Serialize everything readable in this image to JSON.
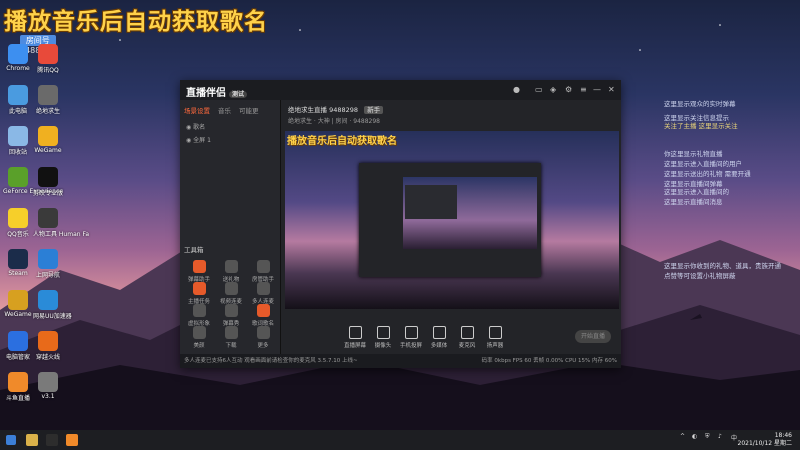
{
  "overlay": {
    "title": "播放音乐后自动获取歌名",
    "badge_top": "房间号",
    "badge_id": "9488298"
  },
  "desktop_icons": [
    {
      "label": "Chrome",
      "color": "#3d8ff0"
    },
    {
      "label": "腾讯QQ",
      "color": "#e84a3a"
    },
    {
      "label": "此电脑",
      "color": "#4a9be0"
    },
    {
      "label": "绝地求生",
      "color": "#6a6a6a"
    },
    {
      "label": "回收站",
      "color": "#8ab8e6"
    },
    {
      "label": "WeGame",
      "color": "#f0b020"
    },
    {
      "label": "GeForce Experience",
      "color": "#5aa02a"
    },
    {
      "label": "剪映专业版",
      "color": "#111111"
    },
    {
      "label": "QQ音乐",
      "color": "#f6cf2a"
    },
    {
      "label": "人物工具 Human Fa",
      "color": "#3a3a3a"
    },
    {
      "label": "Steam",
      "color": "#1b2c4a"
    },
    {
      "label": "上网导航",
      "color": "#2b7fd6"
    },
    {
      "label": "WeGame",
      "color": "#d7a020"
    },
    {
      "label": "网易UU加速器",
      "color": "#2a8bd8"
    },
    {
      "label": "电脑管家",
      "color": "#2b6fe0"
    },
    {
      "label": "穿越火线",
      "color": "#e86a1a"
    },
    {
      "label": "斗鱼直播",
      "color": "#f08a2a"
    },
    {
      "label": "v3.1",
      "color": "#7a7a7a"
    }
  ],
  "chat": [
    {
      "text": "这里显示观众的实时弹幕",
      "hl": false
    },
    {
      "text": "这里显示关注信息提示",
      "hl": false
    },
    {
      "text": "   关注了主播 这里显示关注",
      "hl": true
    },
    {
      "text": "你这里显示礼物直播",
      "hl": false
    },
    {
      "text": "这里显示进入直播间的用户",
      "hl": false
    },
    {
      "text": "这里显示送出的礼物 需要开通",
      "hl": false
    },
    {
      "text": "这里显示直播间弹幕",
      "hl": false
    },
    {
      "text": "这里显示进入直播间的",
      "hl": false
    },
    {
      "text": "这里显示直播间消息",
      "hl": false
    },
    {
      "text": "这里显示你收到的礼物、道具，贵族开通",
      "hl": false
    },
    {
      "text": "点赞等可设置小礼物屏蔽",
      "hl": false
    }
  ],
  "app": {
    "name": "直播伴侣",
    "version": "测试",
    "tabs": [
      "场景设置",
      "音乐",
      "可能更"
    ],
    "scene_items": [
      "歌名",
      "全屏 1"
    ],
    "room_title": "绝地求生直播 9488298",
    "room_tag": "新手",
    "room_sub": "绝地求生 · 大神  |  房间 · 9488298",
    "tools_title": "工具箱",
    "tools": [
      "弹幕助手",
      "送礼物",
      "房管助手",
      "主播任务",
      "视频连麦",
      "多人连麦",
      "虚拟形象",
      "弹幕秀",
      "歌词歌名",
      "美颜",
      "下载",
      "更多"
    ],
    "bottom_tools": [
      "直播屏幕",
      "摄像头",
      "手机投屏",
      "多媒体",
      "麦克风",
      "扬声器"
    ],
    "live_button": "开始直播",
    "preview_title": "播放音乐后自动获取歌名",
    "status_text": "多人连麦已支持6人互动 观看画面前请检查你的麦克风 3.5.7.10 上线~",
    "status_right": "码率 0kbps   FPS 60   丢帧 0.00%   CPU 15%   内存 60%"
  },
  "taskbar": {
    "time": "18:46",
    "date": "2021/10/12 星期二"
  }
}
